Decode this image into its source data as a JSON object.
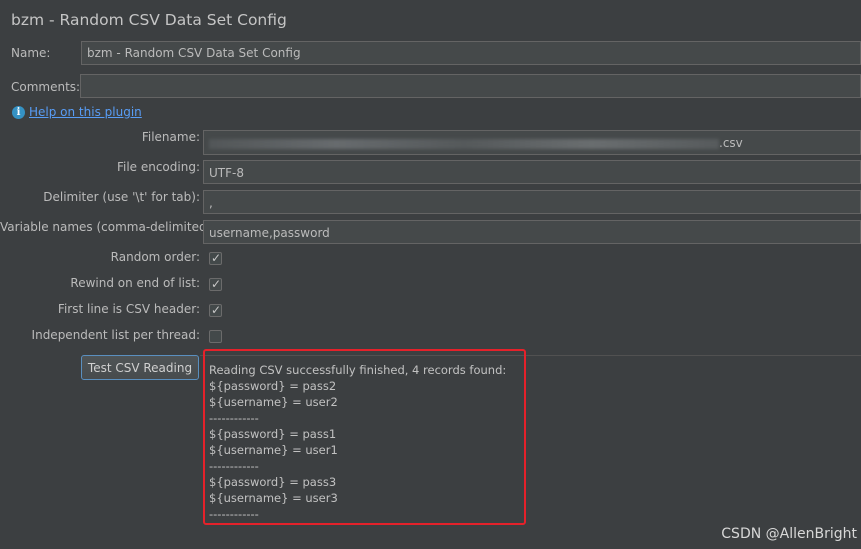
{
  "window": {
    "title": "bzm - Random CSV Data Set Config"
  },
  "form": {
    "name_label": "Name:",
    "name_value": "bzm - Random CSV Data Set Config",
    "comments_label": "Comments:",
    "comments_value": "",
    "help_link": "Help on this plugin",
    "filename_label": "Filename:",
    "filename_suffix": ".csv",
    "encoding_label": "File encoding:",
    "encoding_value": "UTF-8",
    "delimiter_label": "Delimiter (use '\\t' for tab):",
    "delimiter_value": ",",
    "varnames_label": "Variable names (comma-delimited):",
    "varnames_value": "username,password",
    "random_order_label": "Random order:",
    "random_order": true,
    "rewind_label": "Rewind on end of list:",
    "rewind": true,
    "header_label": "First line is CSV header:",
    "header": true,
    "independent_label": "Independent list per thread:",
    "independent": false
  },
  "test": {
    "button_label": "Test CSV Reading",
    "output_lines": [
      "Reading CSV successfully finished, 4 records found:",
      "${password} = pass2",
      "${username} = user2",
      "------------",
      "${password} = pass1",
      "${username} = user1",
      "------------",
      "${password} = pass3",
      "${username} = user3",
      "------------"
    ]
  },
  "watermark": "CSDN @AllenBright",
  "colors": {
    "background": "#3c3f41",
    "field": "#45494a",
    "link": "#589df6",
    "highlight": "#e5212a"
  }
}
